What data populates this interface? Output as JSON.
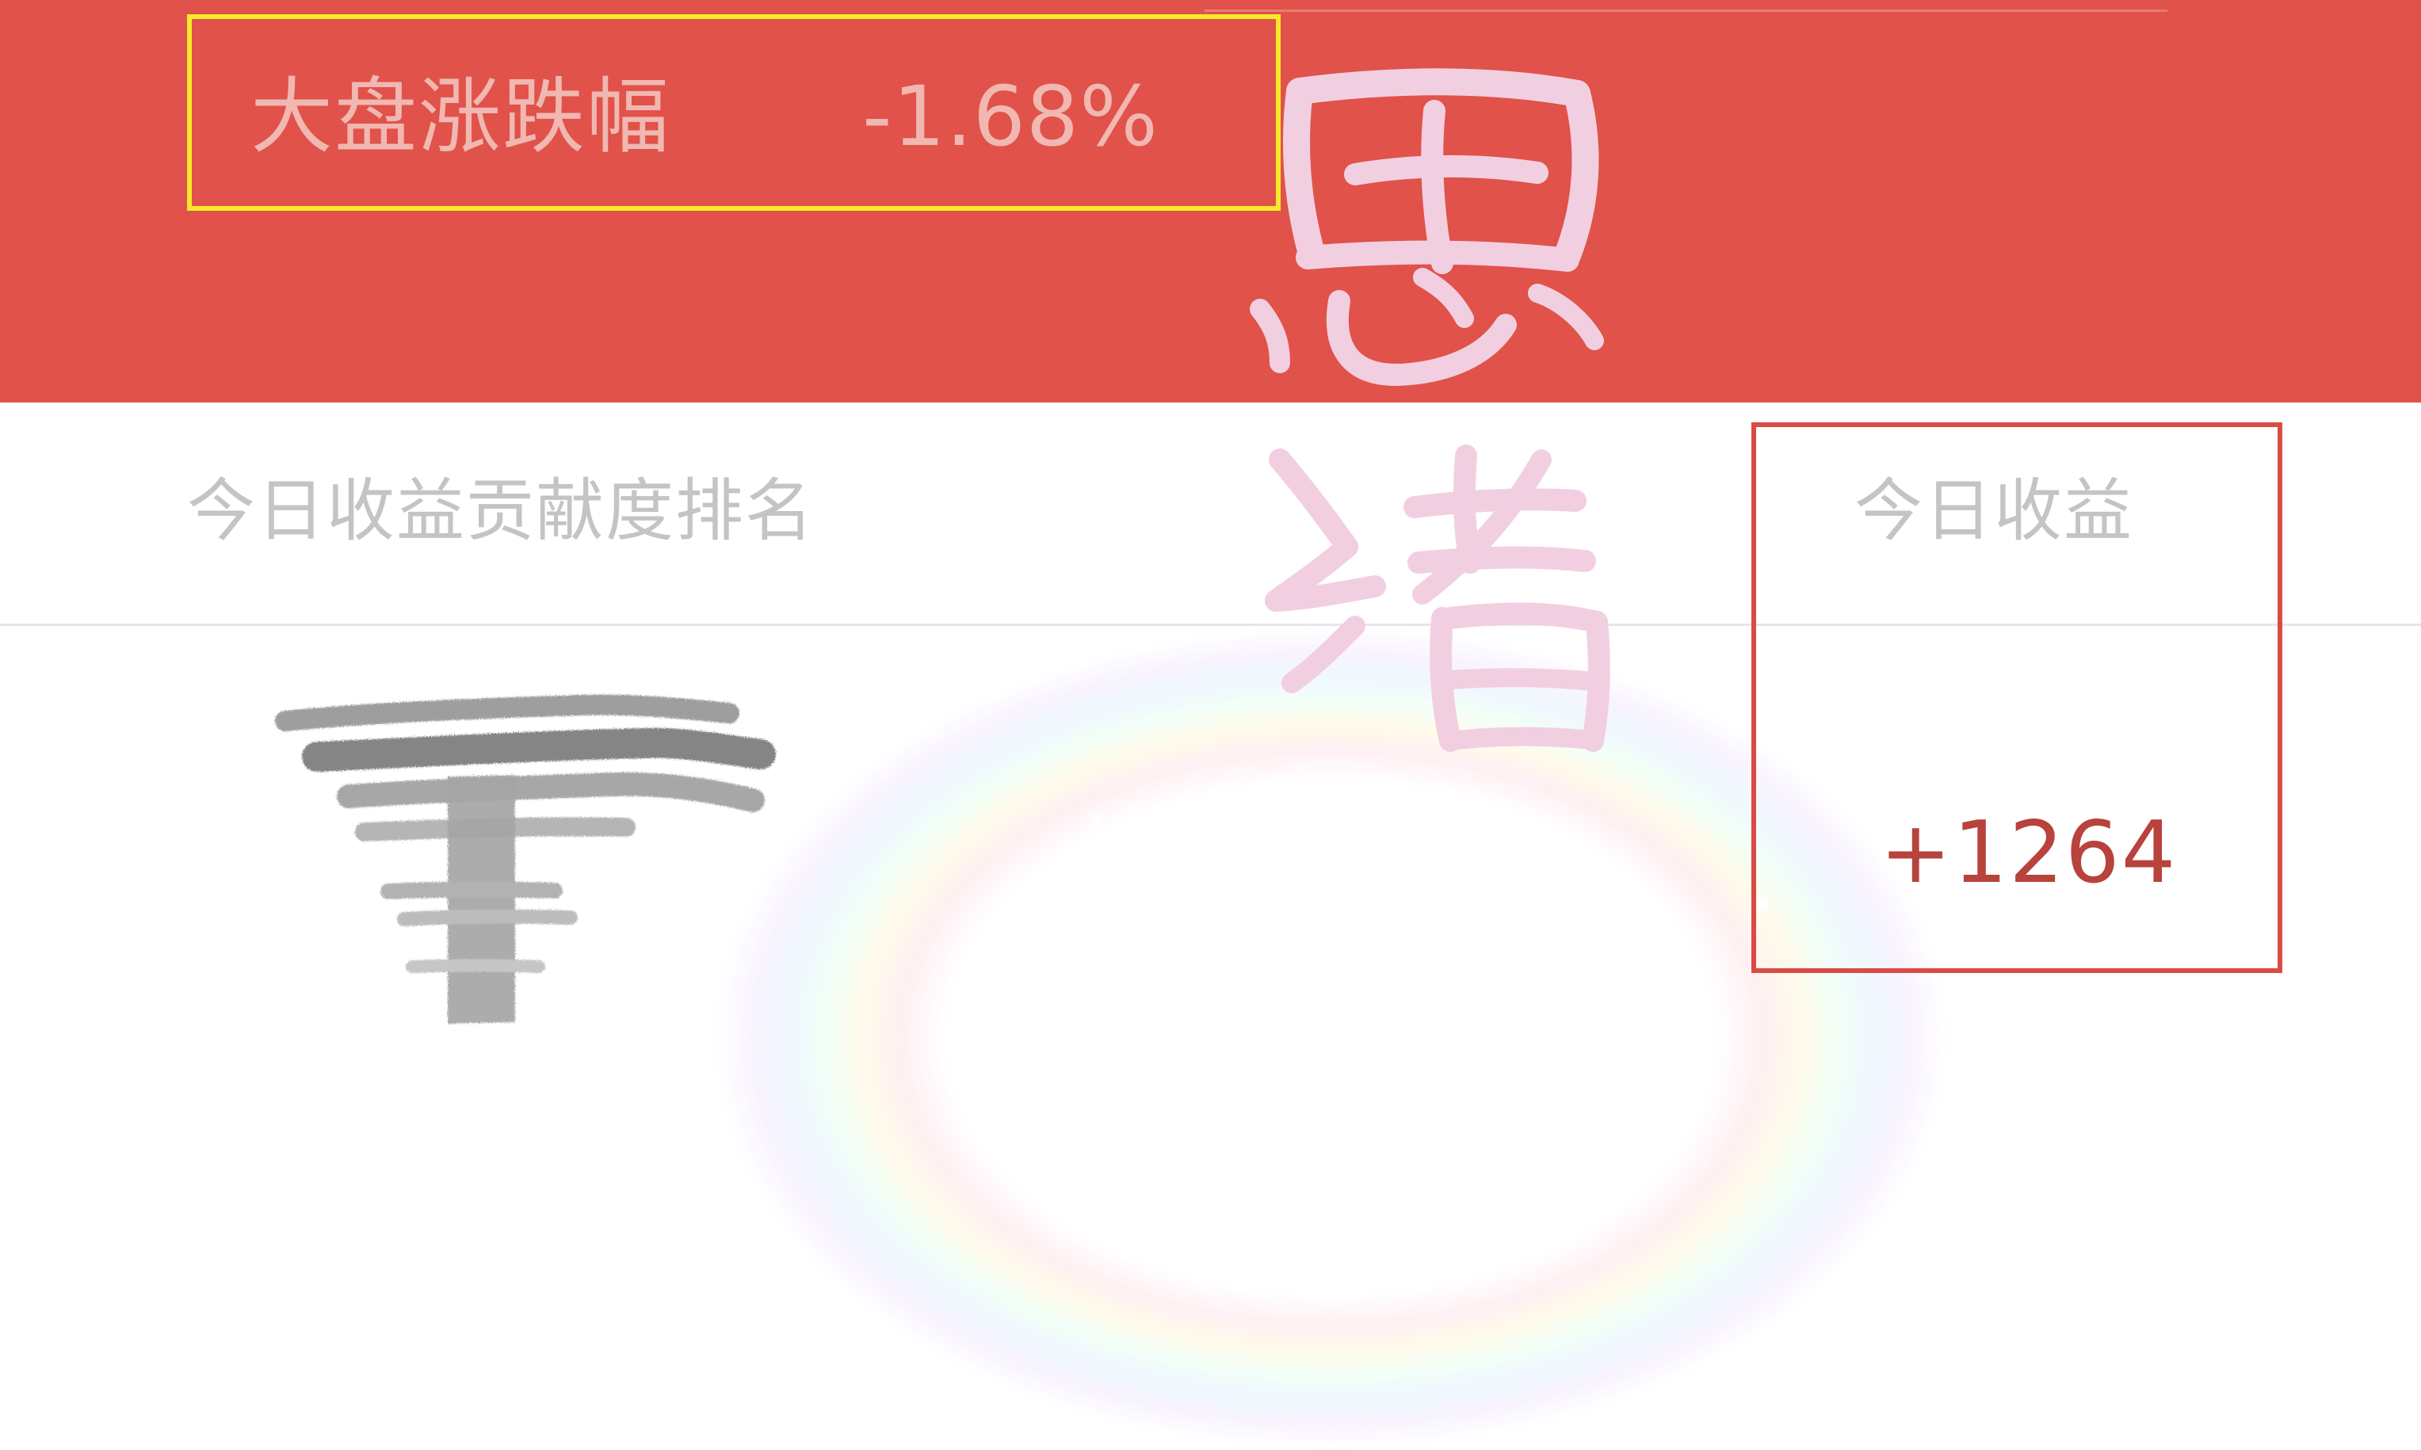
{
  "header": {
    "market_label": "大盘涨跌幅",
    "market_change": "-1.68%"
  },
  "table": {
    "rank_header": "今日收益贡献度排名",
    "earnings_header": "今日收益",
    "rows": [
      {
        "earnings": "+1264"
      }
    ]
  },
  "handwriting": {
    "chars": [
      "思",
      "绪"
    ]
  },
  "colors": {
    "header_red": "#e0524a",
    "highlight_yellow": "#f5ea2b",
    "highlight_red": "#d94b44",
    "positive_value": "#b8423c",
    "muted_text": "#c4c4c4",
    "handwriting_pink": "#f2cfe0"
  }
}
